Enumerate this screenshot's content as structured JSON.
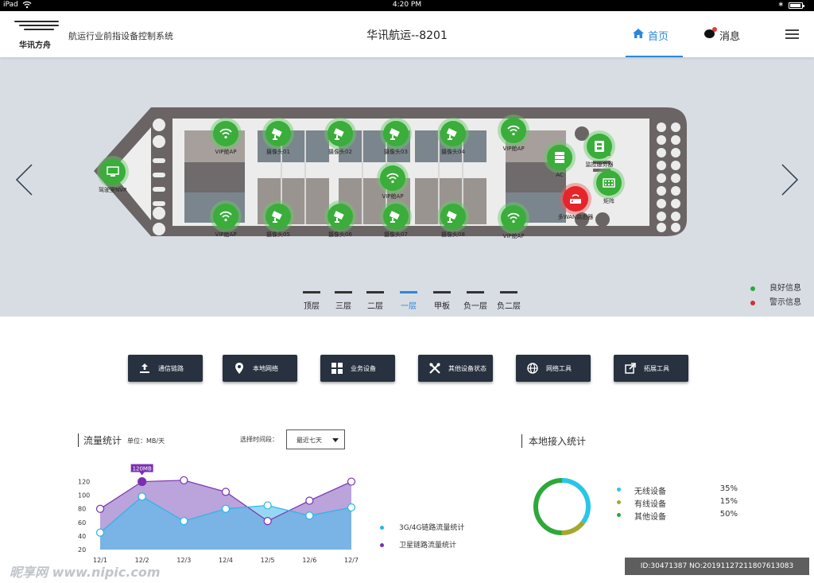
{
  "status_bar": {
    "device": "iPad",
    "time": "4:20 PM"
  },
  "header": {
    "logo_text": "华讯方舟",
    "app_subtitle": "航运行业前指设备控制系统",
    "center_title": "华讯航运--8201",
    "nav_home": "首页",
    "nav_messages": "消息"
  },
  "ship": {
    "nodes": [
      {
        "label": "驾驶室NVR",
        "icon": "nvr-icon",
        "status": "good"
      },
      {
        "label": "VIP舱AP",
        "icon": "wifi-icon",
        "status": "good"
      },
      {
        "label": "摄像头01",
        "icon": "camera-icon",
        "status": "good"
      },
      {
        "label": "摄像头02",
        "icon": "camera-icon",
        "status": "good"
      },
      {
        "label": "摄像头03",
        "icon": "camera-icon",
        "status": "good"
      },
      {
        "label": "摄像头04",
        "icon": "camera-icon",
        "status": "good"
      },
      {
        "label": "VIP舱AP",
        "icon": "wifi-icon",
        "status": "good"
      },
      {
        "label": "VIP舱AP",
        "icon": "wifi-icon",
        "status": "good"
      },
      {
        "label": "AC",
        "icon": "server-icon",
        "status": "good"
      },
      {
        "label": "监控服务器",
        "icon": "monitor-server-icon",
        "status": "good"
      },
      {
        "label": "矩阵",
        "icon": "matrix-icon",
        "status": "good"
      },
      {
        "label": "多WAN路由器",
        "icon": "router-icon",
        "status": "alert"
      },
      {
        "label": "VIP舱AP",
        "icon": "wifi-icon",
        "status": "good"
      },
      {
        "label": "摄像头05",
        "icon": "camera-icon",
        "status": "good"
      },
      {
        "label": "摄像头06",
        "icon": "camera-icon",
        "status": "good"
      },
      {
        "label": "摄像头07",
        "icon": "camera-icon",
        "status": "good"
      },
      {
        "label": "摄像头08",
        "icon": "camera-icon",
        "status": "good"
      },
      {
        "label": "VIP舱AP",
        "icon": "wifi-icon",
        "status": "good"
      }
    ],
    "floor_tabs": [
      "顶层",
      "三层",
      "二层",
      "一层",
      "甲板",
      "负一层",
      "负二层"
    ],
    "active_floor": "一层",
    "legend": [
      {
        "label": "良好信息",
        "color": "#2ea83a"
      },
      {
        "label": "警示信息",
        "color": "#d32f2f"
      }
    ]
  },
  "tools": [
    {
      "label": "通信链路",
      "icon": "upload-icon"
    },
    {
      "label": "本地网络",
      "icon": "location-pin-icon"
    },
    {
      "label": "业务设备",
      "icon": "grid-icon"
    },
    {
      "label": "其他设备状态",
      "icon": "tools-icon"
    },
    {
      "label": "网络工具",
      "icon": "globe-icon"
    },
    {
      "label": "拓展工具",
      "icon": "external-link-icon"
    }
  ],
  "traffic": {
    "title": "流量统计",
    "unit": "单位：MB/天",
    "time_label": "选择时间段：",
    "time_value": "最近七天",
    "legend": [
      {
        "label": "3G/4G链路流量统计",
        "color": "#29b6e8"
      },
      {
        "label": "卫星链路流量统计",
        "color": "#7b2fb0"
      }
    ]
  },
  "chart_data": {
    "type": "area",
    "categories": [
      "12/1",
      "12/2",
      "12/3",
      "12/4",
      "12/5",
      "12/6",
      "12/7"
    ],
    "y_ticks": [
      20,
      40,
      60,
      80,
      100,
      120
    ],
    "ylim": [
      20,
      130
    ],
    "tooltip": {
      "value": "120MB",
      "category": "12/2"
    },
    "series": [
      {
        "name": "3G/4G链路流量统计",
        "color": "#29b6e8",
        "values": [
          45,
          98,
          62,
          80,
          85,
          70,
          82
        ]
      },
      {
        "name": "卫星链路流量统计",
        "color": "#7b2fb0",
        "values": [
          80,
          120,
          122,
          105,
          62,
          92,
          120
        ]
      }
    ]
  },
  "access": {
    "title": "本地接入统计",
    "items": [
      {
        "label": "无线设备",
        "pct": "35%",
        "value": 35,
        "color": "#29c6e8"
      },
      {
        "label": "有线设备",
        "pct": "15%",
        "value": 15,
        "color": "#a3a830"
      },
      {
        "label": "其他设备",
        "pct": "50%",
        "value": 50,
        "color": "#2ea83a"
      }
    ]
  },
  "watermark": {
    "left": "昵享网 www.nipic.com",
    "right": "ID:30471387 NO:20191127211807613083"
  }
}
